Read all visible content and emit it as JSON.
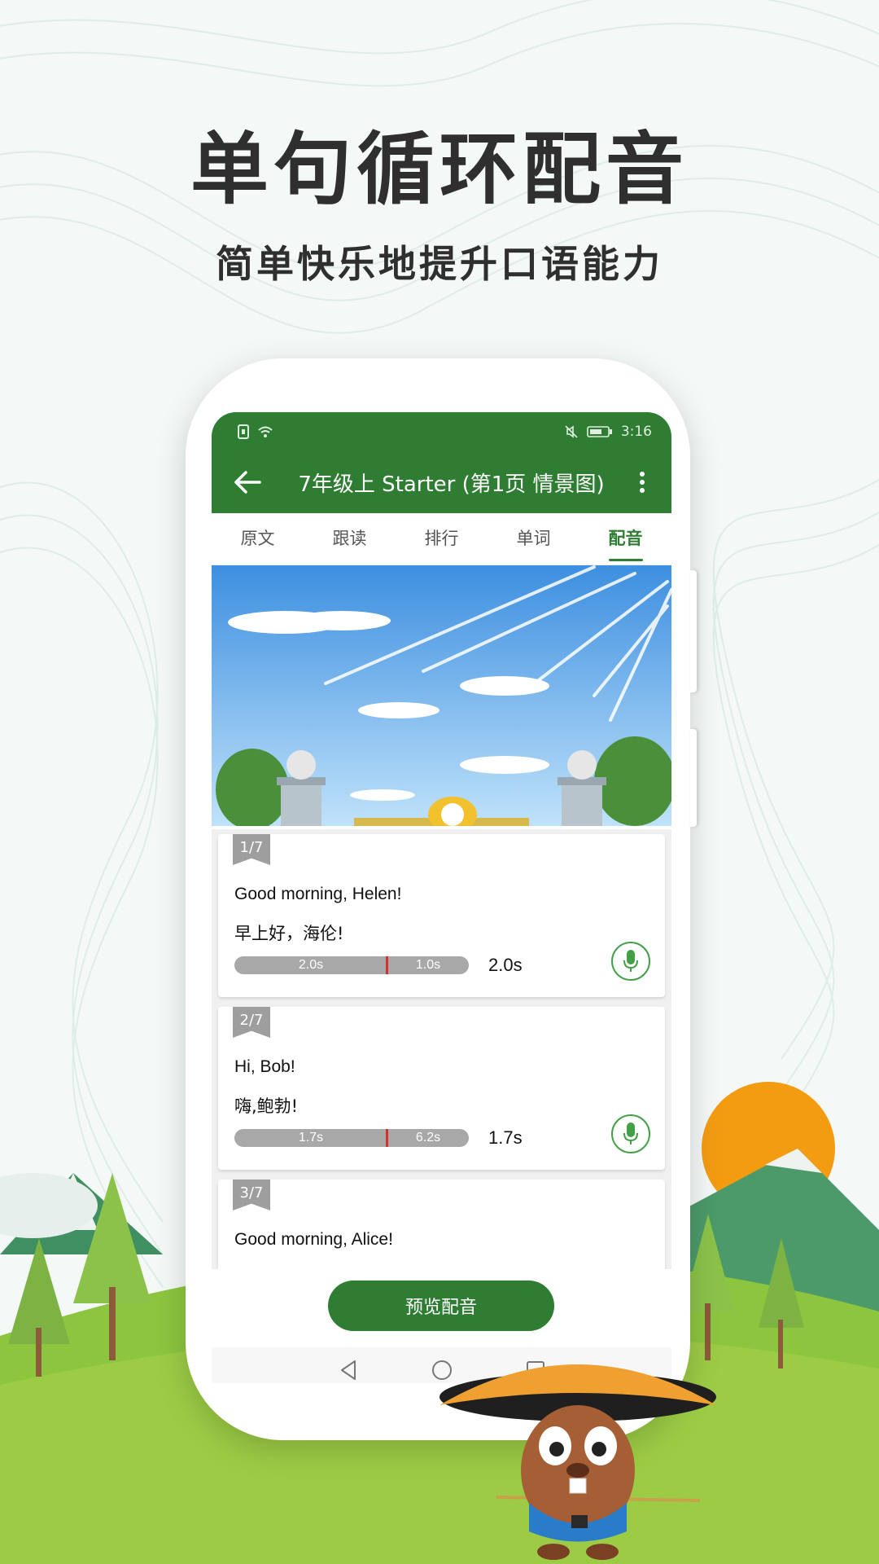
{
  "promo": {
    "headline": "单句循环配音",
    "subline": "简单快乐地提升口语能力"
  },
  "status_bar": {
    "time": "3:16",
    "icons": [
      "sim-icon",
      "wifi-icon",
      "mute-icon",
      "battery-icon"
    ]
  },
  "app_bar": {
    "title": "7年级上 Starter (第1页 情景图)",
    "back_icon": "back-arrow-icon",
    "more_icon": "more-vert-icon"
  },
  "tabs": [
    {
      "label": "原文",
      "active": false
    },
    {
      "label": "跟读",
      "active": false
    },
    {
      "label": "排行",
      "active": false
    },
    {
      "label": "单词",
      "active": false
    },
    {
      "label": "配音",
      "active": true
    }
  ],
  "sentences": [
    {
      "index": "1/7",
      "en": "Good morning, Helen!",
      "zh": "早上好，海伦!",
      "seg_a": "2.0s",
      "seg_b": "1.0s",
      "duration": "2.0s"
    },
    {
      "index": "2/7",
      "en": "Hi, Bob!",
      "zh": "嗨,鲍勃!",
      "seg_a": "1.7s",
      "seg_b": "6.2s",
      "duration": "1.7s"
    },
    {
      "index": "3/7",
      "en": "Good morning, Alice!"
    }
  ],
  "preview_button": "预览配音",
  "colors": {
    "primary": "#2e7d32",
    "mic": "#43a047",
    "marker": "#d32f2f",
    "timeline": "#a8a8a8"
  }
}
